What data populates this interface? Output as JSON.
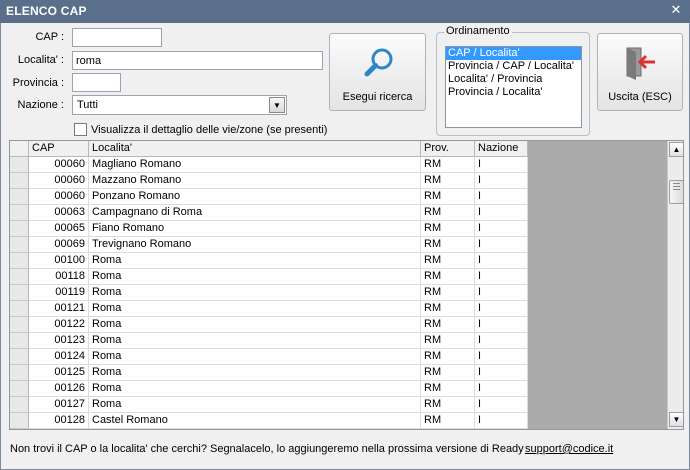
{
  "window": {
    "title": "ELENCO CAP",
    "close_glyph": "✕"
  },
  "form": {
    "cap_label": "CAP :",
    "cap_value": "",
    "localita_label": "Localita' :",
    "localita_value": "roma",
    "provincia_label": "Provincia :",
    "provincia_value": "",
    "nazione_label": "Nazione :",
    "nazione_value": "Tutti",
    "dettaglio_label": "Visualizza il dettaglio delle vie/zone (se presenti)"
  },
  "buttons": {
    "search_label": "Esegui ricerca",
    "search_icon": "magnifier-icon",
    "exit_label": "Uscita (ESC)",
    "exit_icon": "exit-door-icon"
  },
  "ordinamento": {
    "title": "Ordinamento",
    "options": [
      "CAP / Localita'",
      "Provincia / CAP / Localita'",
      "Localita' / Provincia",
      "Provincia / Localita'"
    ],
    "selected_index": 0
  },
  "grid": {
    "headers": [
      "CAP",
      "Localita'",
      "Prov.",
      "Nazione"
    ],
    "rows": [
      [
        "00060",
        "Magliano Romano",
        "RM",
        "I"
      ],
      [
        "00060",
        "Mazzano Romano",
        "RM",
        "I"
      ],
      [
        "00060",
        "Ponzano Romano",
        "RM",
        "I"
      ],
      [
        "00063",
        "Campagnano di Roma",
        "RM",
        "I"
      ],
      [
        "00065",
        "Fiano Romano",
        "RM",
        "I"
      ],
      [
        "00069",
        "Trevignano Romano",
        "RM",
        "I"
      ],
      [
        "00100",
        "Roma",
        "RM",
        "I"
      ],
      [
        "00118",
        "Roma",
        "RM",
        "I"
      ],
      [
        "00119",
        "Roma",
        "RM",
        "I"
      ],
      [
        "00121",
        "Roma",
        "RM",
        "I"
      ],
      [
        "00122",
        "Roma",
        "RM",
        "I"
      ],
      [
        "00123",
        "Roma",
        "RM",
        "I"
      ],
      [
        "00124",
        "Roma",
        "RM",
        "I"
      ],
      [
        "00125",
        "Roma",
        "RM",
        "I"
      ],
      [
        "00126",
        "Roma",
        "RM",
        "I"
      ],
      [
        "00127",
        "Roma",
        "RM",
        "I"
      ],
      [
        "00128",
        "Castel Romano",
        "RM",
        "I"
      ]
    ]
  },
  "footer": {
    "note": "Non trovi il CAP o la localita' che cerchi? Segnalacelo, lo aggiungeremo nella prossima versione di Ready",
    "link": "support@codice.it"
  },
  "colors": {
    "titlebar": "#5a6f8a",
    "selection": "#3399ff",
    "grid_empty": "#ababab",
    "exit_arrow": "#e03030"
  }
}
